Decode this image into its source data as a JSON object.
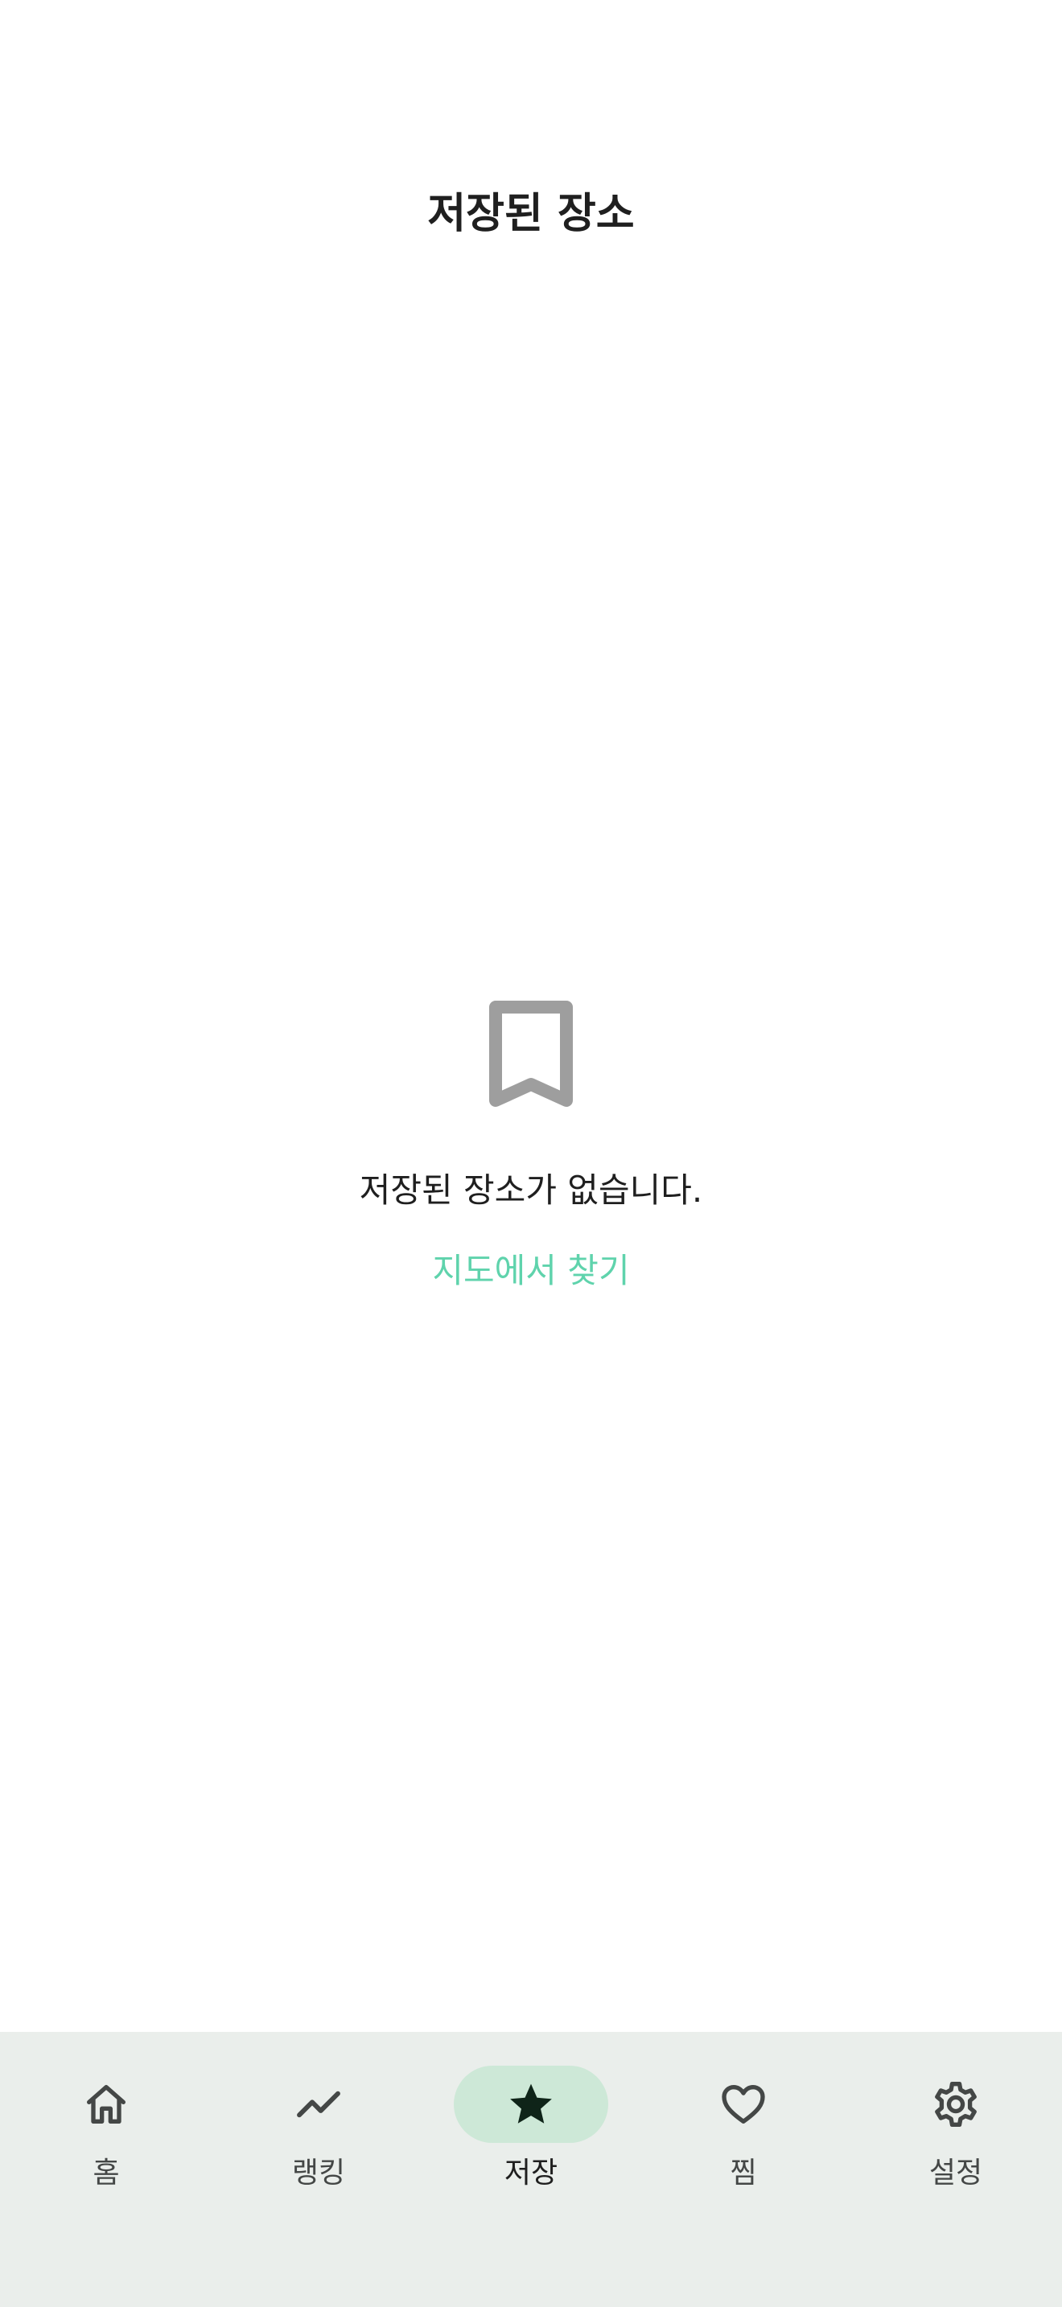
{
  "header": {
    "title": "저장된 장소"
  },
  "empty_state": {
    "icon": "bookmark-icon",
    "message": "저장된 장소가 없습니다.",
    "action_label": "지도에서 찾기",
    "action_color": "#5fd3ac"
  },
  "bottom_nav": {
    "active_index": 2,
    "items": [
      {
        "label": "홈",
        "icon": "home-icon"
      },
      {
        "label": "랭킹",
        "icon": "trending-icon"
      },
      {
        "label": "저장",
        "icon": "star-icon"
      },
      {
        "label": "찜",
        "icon": "heart-icon"
      },
      {
        "label": "설정",
        "icon": "gear-icon"
      }
    ],
    "active_pill_color": "#cde8d7",
    "background_color": "#eaeeeb"
  }
}
